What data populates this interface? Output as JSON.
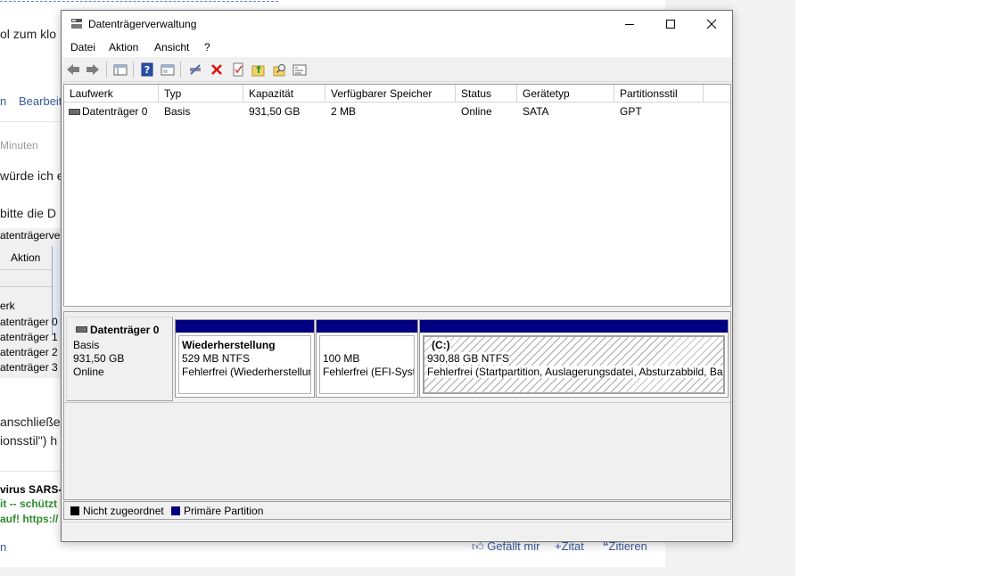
{
  "background_page": {
    "line1": "ol zum klo",
    "tab1": "n",
    "tab2": "Bearbeit",
    "time": "Minuten",
    "para1": "würde ich e",
    "para2": "bitte die D",
    "shot_title": "atenträgerverv",
    "shot_menu": "Aktion",
    "shot_col": "erk",
    "shot_rows": [
      "atenträger 0",
      "atenträger 1",
      "atenträger 2",
      "atenträger 3"
    ],
    "para3": "anschließen",
    "para4": "ionsstil\") h",
    "sig1": "virus SARS-C",
    "sig2": "it -- schützt",
    "sig3": "auf! https://",
    "footer_left": "n",
    "action_like": "Gefällt mir",
    "action_quote": "+Zitat",
    "action_cite": "Zitieren"
  },
  "window": {
    "title": "Datenträgerverwaltung",
    "icon": "disk-management-icon"
  },
  "menu": [
    "Datei",
    "Aktion",
    "Ansicht",
    "?"
  ],
  "toolbar_icons": [
    "back-arrow-icon",
    "forward-arrow-icon",
    "console-tree-icon",
    "help-icon",
    "properties-icon",
    "connect-icon",
    "delete-icon",
    "check-icon",
    "folder-up-icon",
    "folder-search-icon",
    "view-icon"
  ],
  "list": {
    "columns": [
      "Laufwerk",
      "Typ",
      "Kapazität",
      "Verfügbarer Speicher",
      "Status",
      "Gerätetyp",
      "Partitionsstil"
    ],
    "rows": [
      [
        "Datenträger 0",
        "Basis",
        "931,50 GB",
        "2 MB",
        "Online",
        "SATA",
        "GPT"
      ]
    ]
  },
  "disk": {
    "name": "Datenträger 0",
    "type": "Basis",
    "size": "931,50 GB",
    "status": "Online"
  },
  "partitions": [
    {
      "name": "Wiederherstellung",
      "size": "529 MB NTFS",
      "status": "Fehlerfrei (Wiederherstellur"
    },
    {
      "name": "",
      "size": "100 MB",
      "status": "Fehlerfrei (EFI-Syste"
    },
    {
      "name": "(C:)",
      "size": "930,88 GB NTFS",
      "status": "Fehlerfrei (Startpartition, Auslagerungsdatei, Absturzabbild, Bas"
    }
  ],
  "legend": {
    "unallocated": "Nicht zugeordnet",
    "primary": "Primäre Partition",
    "unallocated_color": "#000000",
    "primary_color": "#000080"
  }
}
